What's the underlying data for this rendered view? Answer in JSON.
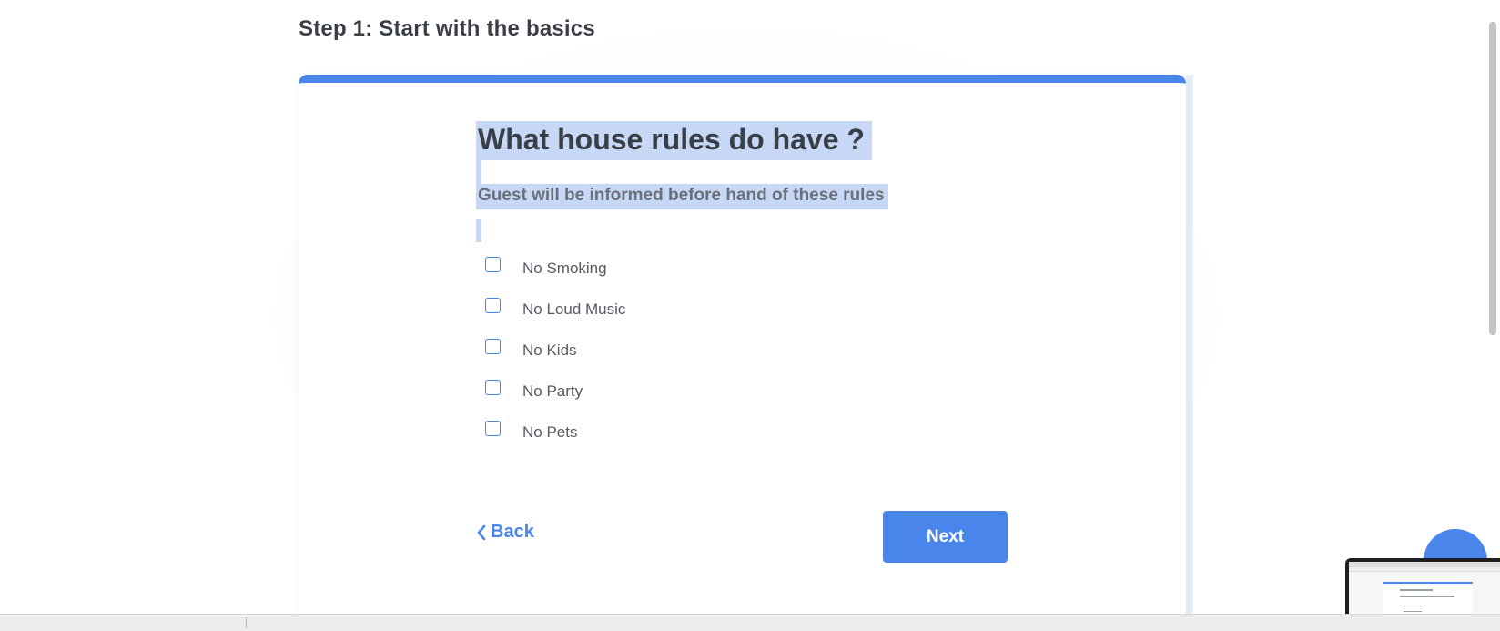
{
  "header": {
    "step_title": "Step 1: Start with the basics"
  },
  "form": {
    "question": "What house rules do have ?",
    "subtitle": "Guest will be informed before hand of these rules",
    "options": [
      {
        "label": "No Smoking",
        "checked": false
      },
      {
        "label": "No Loud Music",
        "checked": false
      },
      {
        "label": "No Kids",
        "checked": false
      },
      {
        "label": "No Party",
        "checked": false
      },
      {
        "label": "No Pets",
        "checked": false
      }
    ],
    "back_label": "Back",
    "next_label": "Next"
  },
  "icons": {
    "back": "chevron-left-icon",
    "chat": "chat-bubble-icon"
  },
  "colors": {
    "accent": "#4a85ec",
    "selection": "#c6d8f5",
    "heading_text": "#3a3f47"
  }
}
